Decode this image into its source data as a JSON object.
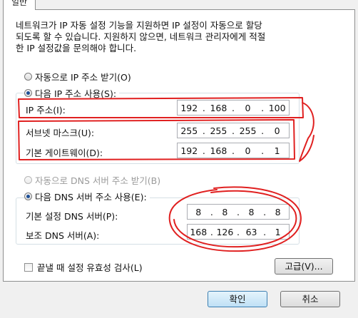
{
  "tab": {
    "label": "일반"
  },
  "description": {
    "lines": [
      "네트워크가 IP 자동 설정 기능을 지원하면 IP 설정이 자동으로 할당",
      "되도록 할 수 있습니다. 지원하지 않으면, 네트워크 관리자에게 적절",
      "한 IP 설정값을 문의해야 합니다."
    ]
  },
  "ip_mode": {
    "auto_label": "자동으로 IP 주소 받기(O)",
    "manual_label": "다음 IP 주소 사용(S):",
    "selected": "manual"
  },
  "ip_fields": {
    "ip_address": {
      "label": "IP 주소(I):",
      "octets": [
        "192",
        "168",
        "0",
        "100"
      ]
    },
    "subnet_mask": {
      "label": "서브넷 마스크(U):",
      "octets": [
        "255",
        "255",
        "255",
        "0"
      ]
    },
    "gateway": {
      "label": "기본 게이트웨이(D):",
      "octets": [
        "192",
        "168",
        "0",
        "1"
      ]
    }
  },
  "dns_mode": {
    "auto_label": "자동으로 DNS 서버 주소 받기(B)",
    "manual_label": "다음 DNS 서버 주소 사용(E):",
    "selected": "manual"
  },
  "dns_fields": {
    "preferred": {
      "label": "기본 설정 DNS 서버(P):",
      "octets": [
        "8",
        "8",
        "8",
        "8"
      ]
    },
    "alternate": {
      "label": "보조 DNS 서버(A):",
      "octets": [
        "168",
        "126",
        "63",
        "1"
      ]
    }
  },
  "validate_checkbox": {
    "label": "끝낼 때 설정 유효성 검사(L)",
    "checked": false
  },
  "buttons": {
    "advanced": "고급(V)...",
    "ok": "확인",
    "cancel": "취소"
  },
  "annotation_color": "#e02020"
}
